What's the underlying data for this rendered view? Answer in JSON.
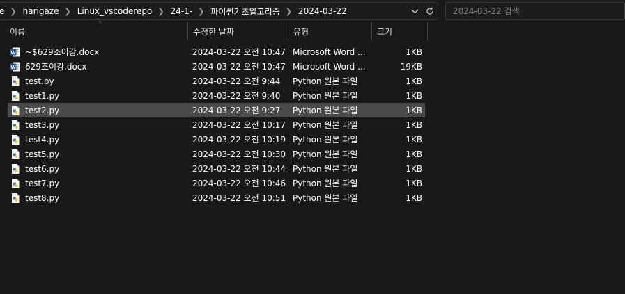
{
  "breadcrumb": [
    "e",
    "harigaze",
    "Linux_vscoderepo",
    "24-1-",
    "파이썬기초알고리즘",
    "2024-03-22"
  ],
  "search": {
    "placeholder": "2024-03-22 검색"
  },
  "columns": {
    "name": "이름",
    "date": "수정한 날짜",
    "type": "유형",
    "size": "크기"
  },
  "files": [
    {
      "name": "~$629조이강.docx",
      "date": "2024-03-22 오전 10:47",
      "type": "Microsoft Word ...",
      "size": "1KB",
      "icon": "word-doc-icon",
      "selected": false
    },
    {
      "name": "629조이강.docx",
      "date": "2024-03-22 오전 10:47",
      "type": "Microsoft Word ...",
      "size": "19KB",
      "icon": "word-doc-icon",
      "selected": false
    },
    {
      "name": "test.py",
      "date": "2024-03-22 오전 9:44",
      "type": "Python 원본 파일",
      "size": "1KB",
      "icon": "python-file-icon",
      "selected": false
    },
    {
      "name": "test1.py",
      "date": "2024-03-22 오전 9:40",
      "type": "Python 원본 파일",
      "size": "1KB",
      "icon": "python-file-icon",
      "selected": false
    },
    {
      "name": "test2.py",
      "date": "2024-03-22 오전 9:27",
      "type": "Python 원본 파일",
      "size": "1KB",
      "icon": "python-file-icon",
      "selected": true
    },
    {
      "name": "test3.py",
      "date": "2024-03-22 오전 10:17",
      "type": "Python 원본 파일",
      "size": "1KB",
      "icon": "python-file-icon",
      "selected": false
    },
    {
      "name": "test4.py",
      "date": "2024-03-22 오전 10:19",
      "type": "Python 원본 파일",
      "size": "1KB",
      "icon": "python-file-icon",
      "selected": false
    },
    {
      "name": "test5.py",
      "date": "2024-03-22 오전 10:30",
      "type": "Python 원본 파일",
      "size": "1KB",
      "icon": "python-file-icon",
      "selected": false
    },
    {
      "name": "test6.py",
      "date": "2024-03-22 오전 10:44",
      "type": "Python 원본 파일",
      "size": "1KB",
      "icon": "python-file-icon",
      "selected": false
    },
    {
      "name": "test7.py",
      "date": "2024-03-22 오전 10:46",
      "type": "Python 원본 파일",
      "size": "1KB",
      "icon": "python-file-icon",
      "selected": false
    },
    {
      "name": "test8.py",
      "date": "2024-03-22 오전 10:51",
      "type": "Python 원본 파일",
      "size": "1KB",
      "icon": "python-file-icon",
      "selected": false
    }
  ],
  "colors": {
    "background": "#191919",
    "selection": "#4a4a4a",
    "word_blue": "#2b579a",
    "python_blue": "#3a78b8"
  }
}
